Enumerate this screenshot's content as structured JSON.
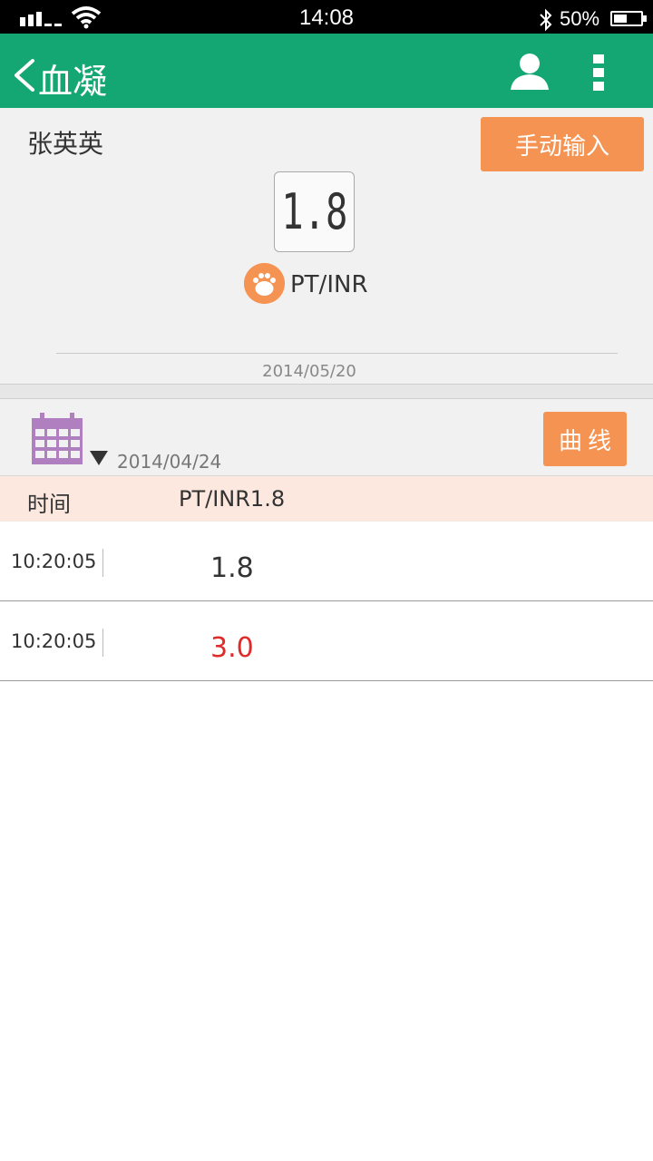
{
  "status_bar": {
    "time": "14:08",
    "battery_percent_text": "50%",
    "battery_level": 0.5,
    "icons": [
      "signal-icon",
      "wifi-icon",
      "bluetooth-icon",
      "battery-icon"
    ]
  },
  "header": {
    "title": "血凝",
    "icons": [
      "back-arrow-icon",
      "person-icon",
      "more-vertical-icon"
    ]
  },
  "summary": {
    "patient_name": "张英英",
    "manual_input_label": "手动输入",
    "reading": "1.8",
    "test_type": "PT/INR",
    "date": "2014/05/20"
  },
  "filter": {
    "date": "2014/04/24",
    "curve_label": "曲线",
    "icons": [
      "calendar-icon",
      "dropdown-triangle-icon"
    ]
  },
  "table": {
    "headers": {
      "time": "时间",
      "value": "PT/INR1.8"
    },
    "rows": [
      {
        "time": "10:20:05",
        "value": "1.8",
        "flag": "normal"
      },
      {
        "time": "10:20:05",
        "value": "3.0",
        "flag": "high"
      }
    ]
  },
  "colors": {
    "header_green": "#15a773",
    "accent_orange": "#f59353",
    "table_header_bg": "#fce8de",
    "high_value_red": "#e02a2a",
    "calendar_purple": "#b07fc0"
  }
}
